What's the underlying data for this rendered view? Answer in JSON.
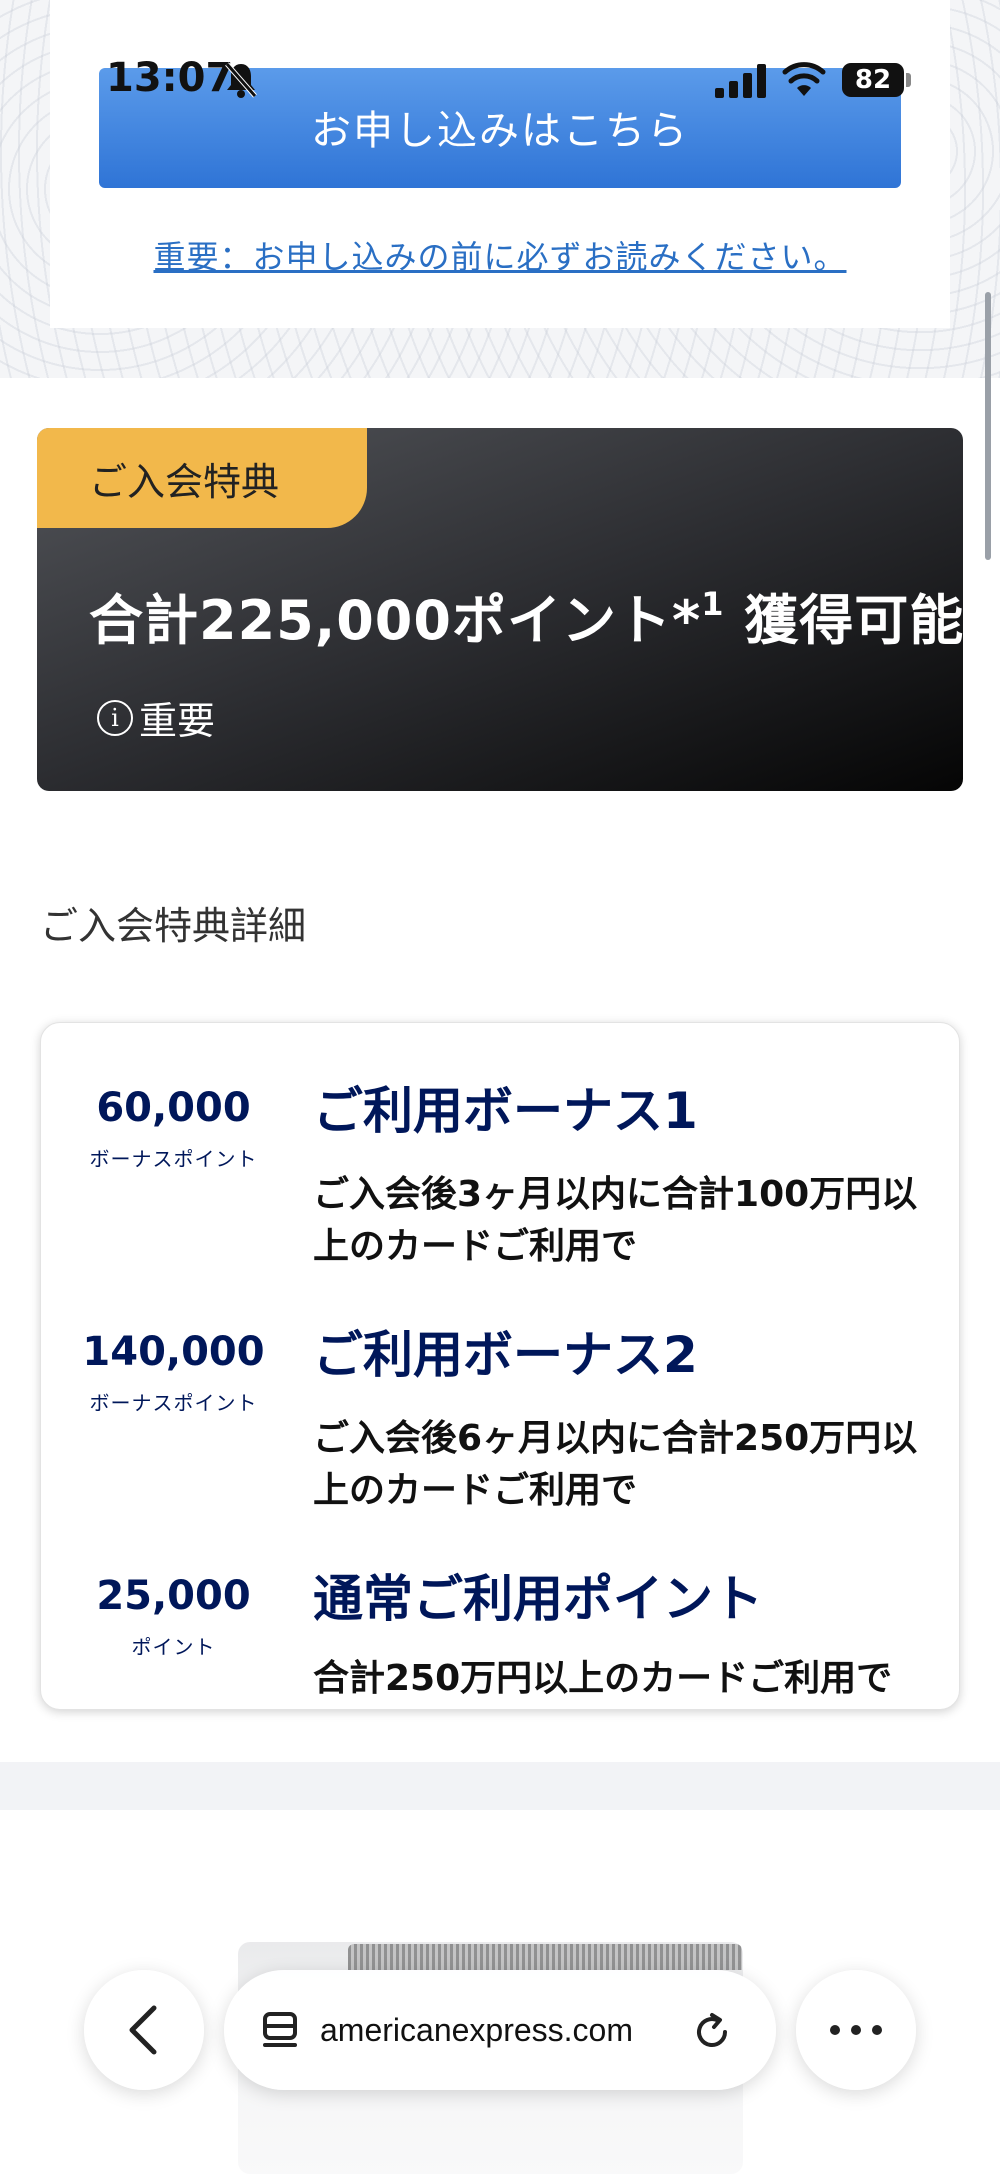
{
  "status_bar": {
    "time": "13:07",
    "battery": "82"
  },
  "top": {
    "apply_button": "お申し込みはこちら",
    "important_link": "重要：お申し込みの前に必ずお読みください。"
  },
  "banner": {
    "tab_label": "ご入会特典",
    "headline": "合計225,000ポイント*",
    "headline_sup": "1",
    "headline_suffix": " 獲得可能",
    "important_label": "重要",
    "important_icon": "info-icon"
  },
  "details": {
    "section_title": "ご入会特典詳細",
    "rows": [
      {
        "points": "60,000",
        "unit": "ボーナスポイント",
        "title": "ご利用ボーナス1",
        "description": "ご入会後3ヶ月以内に合計100万円以上のカードご利用で"
      },
      {
        "points": "140,000",
        "unit": "ボーナスポイント",
        "title": "ご利用ボーナス2",
        "description": "ご入会後6ヶ月以内に合計250万円以上のカードご利用で"
      },
      {
        "points": "25,000",
        "unit": "ポイント",
        "title": "通常ご利用ポイント",
        "description": "合計250万円以上のカードご利用で"
      }
    ]
  },
  "browser": {
    "url": "americanexpress.com",
    "back_icon": "chevron-left-icon",
    "tabs_icon": "tabs-icon",
    "reload_icon": "reload-icon",
    "more_icon": "more-icon"
  },
  "colors": {
    "button_blue": "#2f74d6",
    "tab_gold": "#f2b84b",
    "navy": "#00175a"
  }
}
